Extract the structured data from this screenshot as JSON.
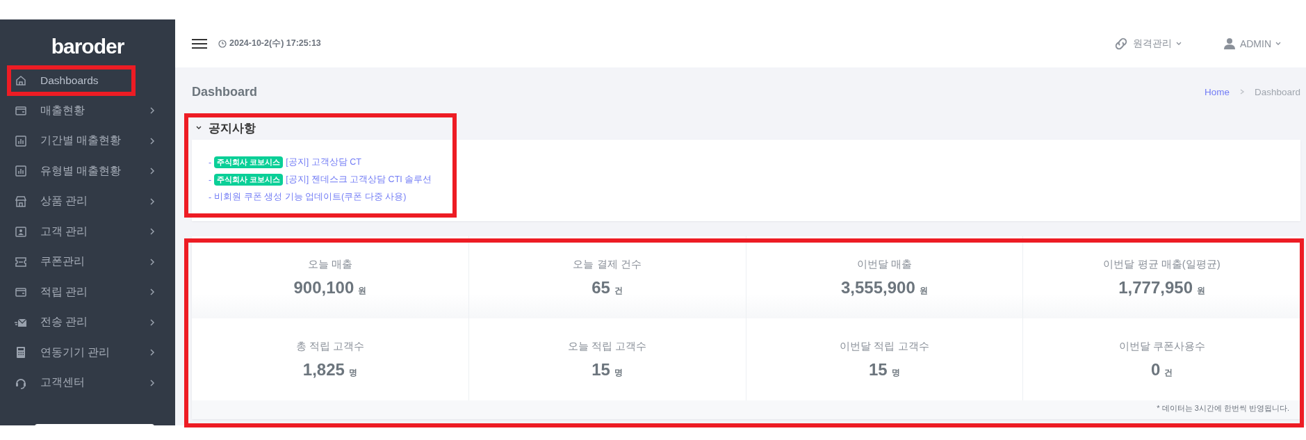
{
  "sidebar": {
    "logo": "baroder",
    "items": [
      {
        "label": "Dashboards",
        "selected": true,
        "highlighted": true,
        "has_submenu": false
      },
      {
        "label": "매출현황",
        "selected": false,
        "highlighted": false,
        "has_submenu": true
      },
      {
        "label": "기간별 매출현황",
        "selected": false,
        "highlighted": false,
        "has_submenu": true
      },
      {
        "label": "유형별 매출현황",
        "selected": false,
        "highlighted": false,
        "has_submenu": true
      },
      {
        "label": "상품 관리",
        "selected": false,
        "highlighted": false,
        "has_submenu": true
      },
      {
        "label": "고객 관리",
        "selected": false,
        "highlighted": false,
        "has_submenu": true
      },
      {
        "label": "쿠폰관리",
        "selected": false,
        "highlighted": false,
        "has_submenu": true
      },
      {
        "label": "적립 관리",
        "selected": false,
        "highlighted": false,
        "has_submenu": true
      },
      {
        "label": "전송 관리",
        "selected": false,
        "highlighted": false,
        "has_submenu": true
      },
      {
        "label": "연동기기 관리",
        "selected": false,
        "highlighted": false,
        "has_submenu": true
      },
      {
        "label": "고객센터",
        "selected": false,
        "highlighted": false,
        "has_submenu": true
      }
    ]
  },
  "header": {
    "datetime": "2024-10-2(수) 17:25:13",
    "remote": "원격관리",
    "user": "ADMIN"
  },
  "page": {
    "title": "Dashboard",
    "breadcrumb": [
      {
        "label": "Home",
        "link": true
      },
      {
        "label": "Dashboard",
        "link": false
      }
    ]
  },
  "notices": {
    "title": "공지사항",
    "expanded": true,
    "highlighted": true,
    "items": [
      {
        "prefix": "-",
        "badge": "주식회사 코보시스",
        "text": "[공지] 고객상담 CT"
      },
      {
        "prefix": "-",
        "badge": "주식회사 코보시스",
        "text": "[공지] 젠데스크 고객상담 CTI 솔루션"
      },
      {
        "prefix": "-",
        "text": "비회원 쿠폰 생성 기능 업데이트(쿠폰 다중 사용)"
      }
    ]
  },
  "stats": {
    "highlighted": true,
    "cards": [
      {
        "label": "오늘 매출",
        "value": "900,100",
        "unit": "원"
      },
      {
        "label": "오늘 결제 건수",
        "value": "65",
        "unit": "건"
      },
      {
        "label": "이번달 매출",
        "value": "3,555,900",
        "unit": "원"
      },
      {
        "label": "이번달 평균 매출(일평균)",
        "value": "1,777,950",
        "unit": "원"
      },
      {
        "label": "총 적립 고객수",
        "value": "1,825",
        "unit": "명"
      },
      {
        "label": "오늘 적립 고객수",
        "value": "15",
        "unit": "명"
      },
      {
        "label": "이번달 적립 고객수",
        "value": "15",
        "unit": "명"
      },
      {
        "label": "이번달 쿠폰사용수",
        "value": "0",
        "unit": "건"
      }
    ],
    "note": "* 데이터는 3시간에 한번씩 반영됩니다."
  }
}
